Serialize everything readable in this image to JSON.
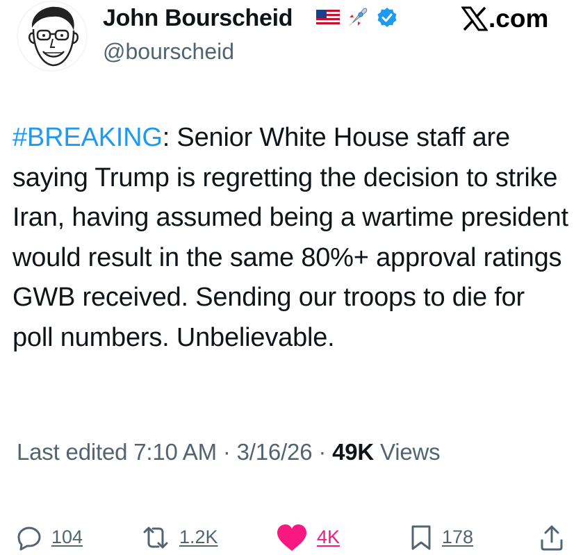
{
  "author": {
    "display_name": "John Bourscheid",
    "handle": "@bourscheid",
    "badges": [
      "us-flag-icon",
      "rocket-icon",
      "verified-badge-icon"
    ]
  },
  "source_label": ".com",
  "tweet": {
    "hashtag": "#BREAKING",
    "text": ": Senior White House staff are saying Trump is regretting the decision to strike Iran, having assumed being a wartime president would result in the same 80%+ approval ratings GWB received. Sending our troops to die for poll numbers. Unbelievable."
  },
  "meta": {
    "edited_label": "Last edited",
    "time": "7:10 AM",
    "separator": " · ",
    "date": "3/16/26",
    "views_count": "49K",
    "views_label": "Views"
  },
  "actions": {
    "replies": "104",
    "reposts": "1.2K",
    "likes": "4K",
    "bookmarks": "178"
  },
  "colors": {
    "accent": "#1d9bf0",
    "like": "#f91880",
    "muted": "#536471",
    "text": "#0f1419"
  }
}
